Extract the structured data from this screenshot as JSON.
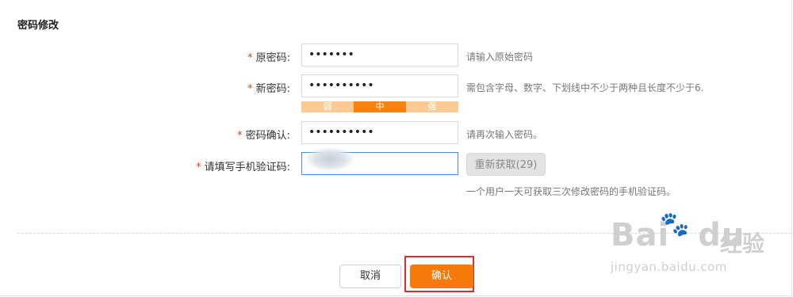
{
  "section_title": "密码修改",
  "required_mark": "*",
  "form": {
    "old_password": {
      "label": "原密码:",
      "value": "•••••••",
      "hint": "请输入原始密码"
    },
    "new_password": {
      "label": "新密码:",
      "value": "••••••••••",
      "hint": "需包含字母、数字、下划线中不少于两种且长度不少于6."
    },
    "strength": {
      "weak": "弱",
      "medium": "中",
      "strong": "强",
      "level": "medium"
    },
    "confirm_password": {
      "label": "密码确认:",
      "value": "••••••••••",
      "hint": "请再次输入密码。"
    },
    "sms_code": {
      "label": "请填写手机验证码:",
      "resend_label": "重新获取(29)",
      "hint": "一个用户一天可获取三次修改密码的手机验证码。"
    }
  },
  "buttons": {
    "cancel": "取消",
    "confirm": "确认"
  },
  "watermark": {
    "brand": "Bai",
    "brand_suffix": "du",
    "cn": "经验",
    "url": "jingyan.baidu.com"
  },
  "colors": {
    "accent": "#f7790c",
    "required": "#e83e1a",
    "highlight": "#e52a2a"
  }
}
